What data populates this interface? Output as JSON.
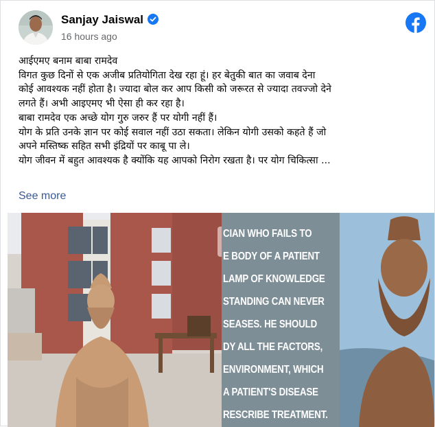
{
  "post": {
    "author_name": "Sanjay Jaiswal",
    "timestamp": "16 hours ago",
    "lines": [
      "आईएमए बनाम बाबा रामदेव",
      "विगत कुछ दिनों से एक अजीब प्रतियोगिता देख रहा हूं। हर बेतुकी बात का जवाब देना",
      "कोई आवश्यक नहीं होता है। ज्यादा बोल कर आप किसी को जरूरत से ज्यादा तवज्जो देने",
      "लगते हैं। अभी आइएमए भी ऐसा ही कर रहा है।",
      "बाबा रामदेव एक अच्छे योग गुरु जरुर हैं पर योगी नहीं हैं।",
      "योग के प्रति उनके ज्ञान पर कोई सवाल नहीं उठा सकता। लेकिन योगी उसको कहते हैं जो",
      "अपने मस्तिष्क सहित सभी इंद्रियों पर काबू पा ले।",
      "योग जीवन में बहुत आवश्यक है क्योंकि यह आपको निरोग रखता है। पर योग चिकित्सा ..."
    ],
    "see_more": "See more"
  },
  "media": {
    "quote_lines": [
      "CIAN WHO FAILS TO",
      "E BODY OF A PATIENT",
      "LAMP OF KNOWLEDGE",
      "STANDING CAN NEVER",
      "SEASES. HE SHOULD",
      "DY ALL THE FACTORS,",
      "ENVIRONMENT, WHICH",
      "A PATIENT'S DISEASE",
      "RESCRIBE TREATMENT."
    ]
  },
  "colors": {
    "brand_blue": "#1877f2",
    "link_blue": "#385898",
    "meta_gray": "#65676b"
  },
  "icons": [
    "verified-badge-icon",
    "facebook-logo-icon"
  ]
}
